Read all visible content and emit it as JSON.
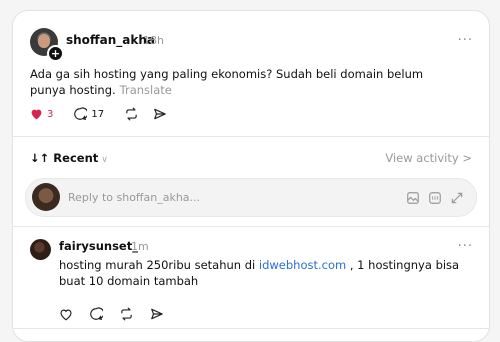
{
  "post": {
    "username": "shoffan_akha",
    "time": "18h",
    "more_label": "···",
    "text": "Ada ga sih hosting yang paling ekonomis? Sudah beli domain belum punya hosting.",
    "translate_label": "Translate",
    "likes": "3",
    "replies": "17",
    "like_color": "#d6244c"
  },
  "sort": {
    "label": "Recent",
    "view_activity": "View activity >"
  },
  "reply_box": {
    "placeholder": "Reply to shoffan_akha..."
  },
  "comment": {
    "username": "fairysunset_",
    "time": "1m",
    "more_label": "···",
    "text_before": "hosting murah 250ribu setahun di ",
    "link_text": "idwebhost.com",
    "text_after": " , 1 hostingnya bisa buat 10 domain tambah",
    "link_color": "#2a6fd6"
  },
  "icons": {
    "post_actions": [
      "heart-icon",
      "comment-icon",
      "repost-icon",
      "share-icon"
    ],
    "reply_tools": [
      "image-icon",
      "gif-icon",
      "expand-icon"
    ],
    "comment_actions": [
      "heart-icon",
      "comment-icon",
      "repost-icon",
      "share-icon"
    ]
  }
}
